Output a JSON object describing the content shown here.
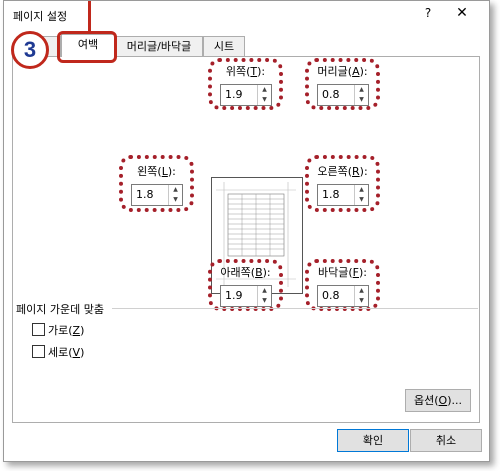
{
  "window": {
    "title": "페이지 설정",
    "help_glyph": "?",
    "close_glyph": "✕"
  },
  "tabs": [
    {
      "label": "여백",
      "active": true
    },
    {
      "label": "머리글/바닥글",
      "active": false
    },
    {
      "label": "시트",
      "active": false
    }
  ],
  "annotation": {
    "step_number": "3",
    "color": "#c0281c"
  },
  "margins": {
    "top": {
      "label": "위쪽",
      "key": "T",
      "value": "1.9"
    },
    "header": {
      "label": "머리글",
      "key": "A",
      "value": "0.8"
    },
    "left": {
      "label": "왼쪽",
      "key": "L",
      "value": "1.8"
    },
    "right": {
      "label": "오른쪽",
      "key": "R",
      "value": "1.8"
    },
    "bottom": {
      "label": "아래쪽",
      "key": "B",
      "value": "1.9"
    },
    "footer": {
      "label": "바닥글",
      "key": "F",
      "value": "0.8"
    }
  },
  "centering": {
    "title": "페이지 가운데 맞춤",
    "horizontal": {
      "label": "가로",
      "key": "Z",
      "checked": false
    },
    "vertical": {
      "label": "세로",
      "key": "V",
      "checked": false
    }
  },
  "buttons": {
    "options": {
      "label": "옵션",
      "key": "O",
      "suffix": "..."
    },
    "ok": "확인",
    "cancel": "취소"
  },
  "colors": {
    "highlight": "#a5202a",
    "accent": "#0078d7"
  }
}
